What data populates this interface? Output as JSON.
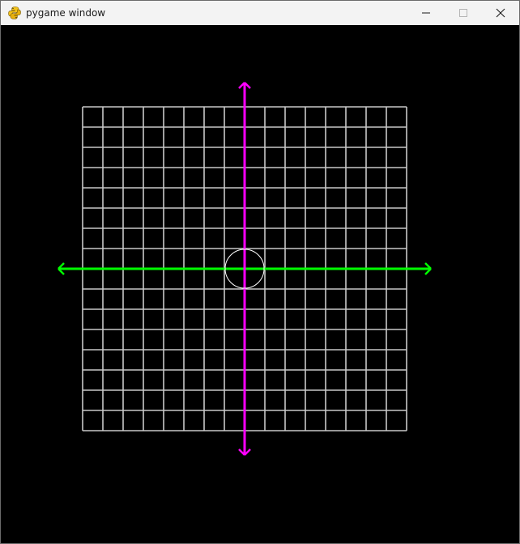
{
  "window": {
    "title": "pygame window",
    "icon": "pygame-snake-icon",
    "controls": {
      "minimize_icon": "minimize-icon",
      "maximize_icon": "maximize-icon",
      "close_icon": "close-icon"
    }
  },
  "scene": {
    "background_color": "#000000",
    "grid": {
      "columns": 16,
      "rows": 16,
      "line_color": "#c8c8c8"
    },
    "x_axis": {
      "color": "#00ff00",
      "arrows": "both-ends"
    },
    "y_axis": {
      "color": "#ff00ff",
      "arrows": "both-ends"
    },
    "origin_circle": {
      "color": "#ffffff"
    }
  }
}
